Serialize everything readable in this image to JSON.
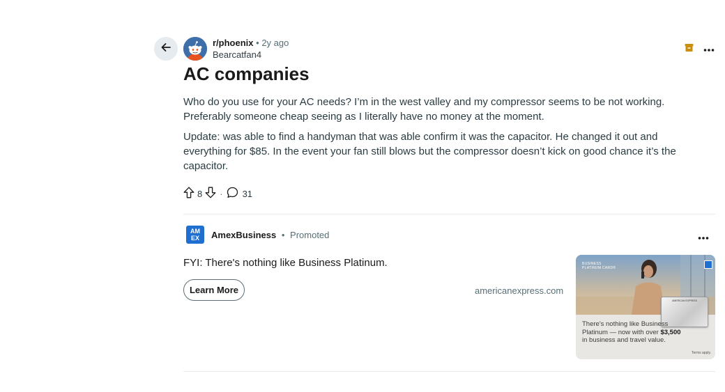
{
  "post": {
    "subreddit": "r/phoenix",
    "separator": "•",
    "age": "2y ago",
    "author": "Bearcatfan4",
    "title": "AC companies",
    "body": [
      "Who do you use for your AC needs? I’m in the west valley and my compressor seems to be not working. Preferably someone cheap seeing as I literally have no money at the moment.",
      "Update: was able to find a handyman that was able confirm it was the capacitor. He changed it out and everything for $85. In the event your fan still blows but the compressor doesn’t kick on good chance it’s the capacitor."
    ],
    "upvotes": "8",
    "action_separator": "·",
    "comments": "31"
  },
  "icons": {
    "back": "arrow-left-icon",
    "avatar": "reddit-snoo-icon",
    "save": "archive-icon",
    "more": "more-horizontal-icon",
    "upvote": "upvote-arrow-icon",
    "downvote": "downvote-arrow-icon",
    "comment": "comment-bubble-icon"
  },
  "colors": {
    "avatar_bg": "#3f6fa8",
    "archive_icon": "#c98e0d",
    "amex_blue": "#1f6fd1",
    "muted_text": "#576f76"
  },
  "ad": {
    "logo_text": "AM EX",
    "advertiser": "AmexBusiness",
    "separator": "•",
    "label": "Promoted",
    "headline": "FYI: There's nothing like Business Platinum.",
    "cta": "Learn More",
    "domain": "americanexpress.com",
    "image": {
      "brand_line1": "BUSINESS",
      "brand_line2": "PLATINUM CARD®",
      "caption_pre": "There's nothing like Business Platinum — now with over ",
      "caption_bold": "$3,500",
      "caption_post": " in business and travel value.",
      "terms": "Terms apply.",
      "card_text": "AMERICAN EXPRESS"
    }
  }
}
